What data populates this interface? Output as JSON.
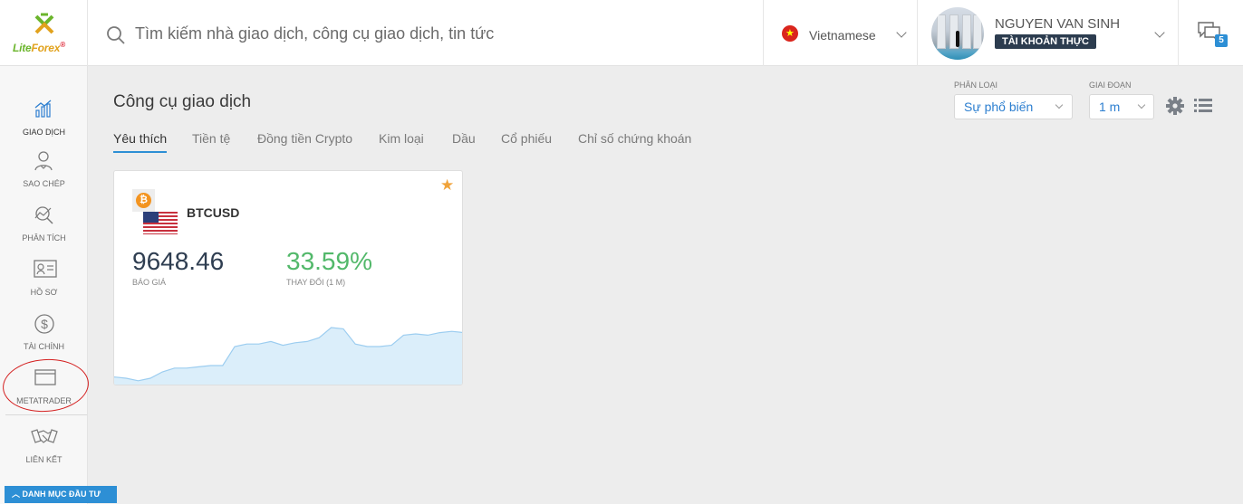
{
  "brand": {
    "name_part1": "Lite",
    "name_part2": "Forex"
  },
  "search": {
    "placeholder": "Tìm kiếm nhà giao dịch, công cụ giao dịch, tin tức"
  },
  "language": {
    "label": "Vietnamese",
    "flag": "vn-flag-icon"
  },
  "user": {
    "name": "NGUYEN VAN SINH",
    "account_badge": "TÀI KHOẢN THỰC"
  },
  "messages": {
    "count": "5"
  },
  "sidebar": {
    "items": [
      {
        "label": "GIAO DỊCH",
        "icon": "trading-chart-icon"
      },
      {
        "label": "SAO CHÉP",
        "icon": "copy-trader-icon"
      },
      {
        "label": "PHÂN TÍCH",
        "icon": "analysis-icon"
      },
      {
        "label": "HỒ SƠ",
        "icon": "profile-card-icon"
      },
      {
        "label": "TÀI CHÍNH",
        "icon": "dollar-icon"
      },
      {
        "label": "METATRADER",
        "icon": "window-icon"
      },
      {
        "label": "LIÊN KẾT",
        "icon": "handshake-icon"
      }
    ],
    "portfolio_button": "DANH MỤC ĐẦU TƯ"
  },
  "main": {
    "title": "Công cụ giao dịch",
    "tabs": [
      "Yêu thích",
      "Tiền tệ",
      "Đồng tiền Crypto",
      "Kim loại",
      "Dầu",
      "Cổ phiếu",
      "Chỉ số chứng khoán"
    ],
    "active_tab": "Yêu thích",
    "filters": {
      "category_label": "PHÂN LOẠI",
      "category_value": "Sự phổ biến",
      "period_label": "GIAI ĐOẠN",
      "period_value": "1 m"
    }
  },
  "card": {
    "symbol": "BTCUSD",
    "price": "9648.46",
    "price_label": "BÁO GIÁ",
    "change": "33.59%",
    "change_label": "THAY ĐỔI (1 M)",
    "favorite": true,
    "colors": {
      "change": "#52b86a",
      "chart_fill": "#dbeefa",
      "chart_line": "#9ccdf0"
    }
  },
  "chart_data": {
    "type": "area",
    "values": [
      0.16,
      0.15,
      0.13,
      0.15,
      0.2,
      0.23,
      0.23,
      0.24,
      0.25,
      0.25,
      0.4,
      0.42,
      0.42,
      0.44,
      0.41,
      0.43,
      0.44,
      0.47,
      0.55,
      0.54,
      0.42,
      0.4,
      0.4,
      0.41,
      0.49,
      0.5,
      0.49,
      0.51,
      0.52,
      0.51
    ]
  },
  "colors": {
    "accent": "#2d8fd5",
    "annotation": "#d42020"
  }
}
